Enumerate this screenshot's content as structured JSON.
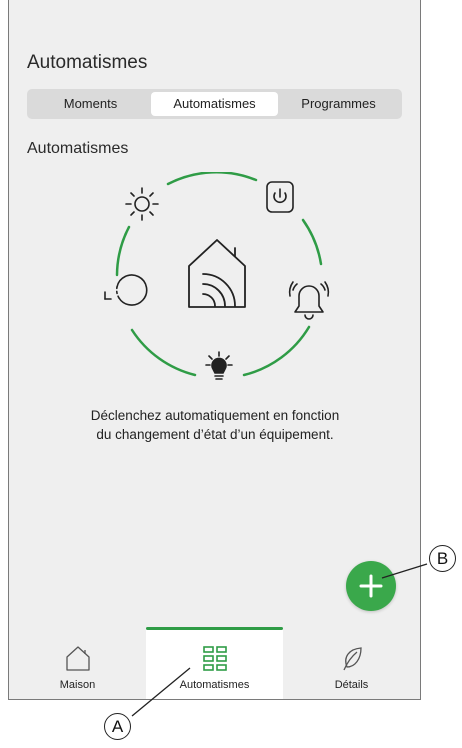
{
  "page": {
    "title": "Automatismes"
  },
  "tabs": [
    {
      "label": "Moments",
      "active": false
    },
    {
      "label": "Automatismes",
      "active": true
    },
    {
      "label": "Programmes",
      "active": false
    }
  ],
  "section": {
    "title": "Automatismes",
    "description_line1": "Déclenchez automatiquement en fonction",
    "description_line2": "du changement d’état d’un équipement."
  },
  "illustration": {
    "icons": [
      "sun-icon",
      "power-icon",
      "alarm-bell-icon",
      "lightbulb-icon",
      "clock-icon",
      "smart-home-icon"
    ],
    "arc_color": "#2f9c46"
  },
  "fab": {
    "icon": "plus-icon",
    "color": "#3aa84b"
  },
  "bottom_nav": [
    {
      "label": "Maison",
      "icon": "house-icon",
      "active": false
    },
    {
      "label": "Automatismes",
      "icon": "grid-icon",
      "active": true
    },
    {
      "label": "Détails",
      "icon": "leaf-icon",
      "active": false
    }
  ],
  "callouts": {
    "a": "A",
    "b": "B"
  },
  "colors": {
    "accent": "#2f9c46",
    "background": "#efefef"
  }
}
